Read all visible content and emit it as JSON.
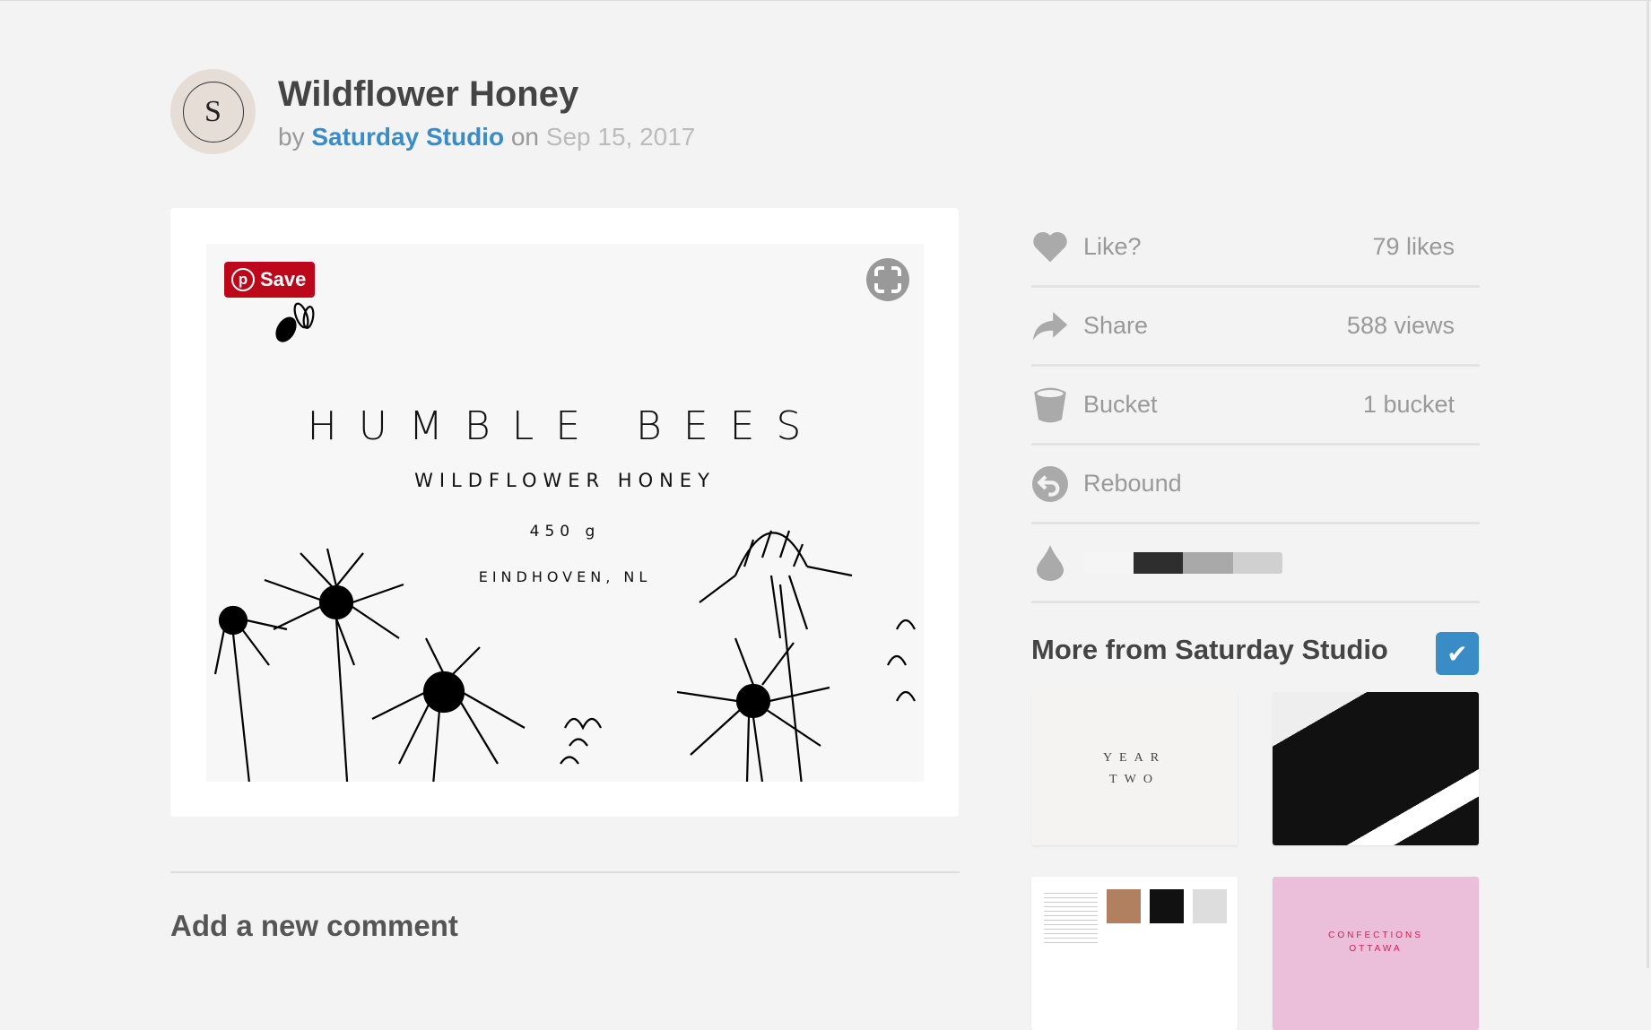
{
  "header": {
    "avatar_letter": "S",
    "title": "Wildflower Honey",
    "by": "by",
    "author": "Saturday Studio",
    "on": "on",
    "date": "Sep 15, 2017"
  },
  "shot": {
    "save_label": "Save",
    "brand": "HUMBLE BEES",
    "product": "WILDFLOWER HONEY",
    "weight": "450 g",
    "location": "EINDHOVEN, NL"
  },
  "stats": [
    {
      "label": "Like?",
      "count": "79 likes",
      "icon": "heart-icon"
    },
    {
      "label": "Share",
      "count": "588 views",
      "icon": "share-arrow-icon"
    },
    {
      "label": "Bucket",
      "count": "1 bucket",
      "icon": "bucket-icon"
    },
    {
      "label": "Rebound",
      "icon": "rebound-icon"
    }
  ],
  "palette": {
    "icon": "droplet-icon",
    "colors": [
      "#f5f5f5",
      "#2e2e2e",
      "#a9a9a9",
      "#d0d0d0"
    ]
  },
  "more": {
    "title": "More from Saturday Studio",
    "thumbs": [
      {
        "text1": "YEAR",
        "text2": "TWO"
      },
      {},
      {},
      {
        "text1": "CONFECTIONS",
        "text2": "OTTAWA"
      }
    ]
  },
  "comments": {
    "title": "Add a new comment"
  },
  "colors": {
    "accent": "#3a8cc6",
    "pinterest": "#bd081c"
  }
}
